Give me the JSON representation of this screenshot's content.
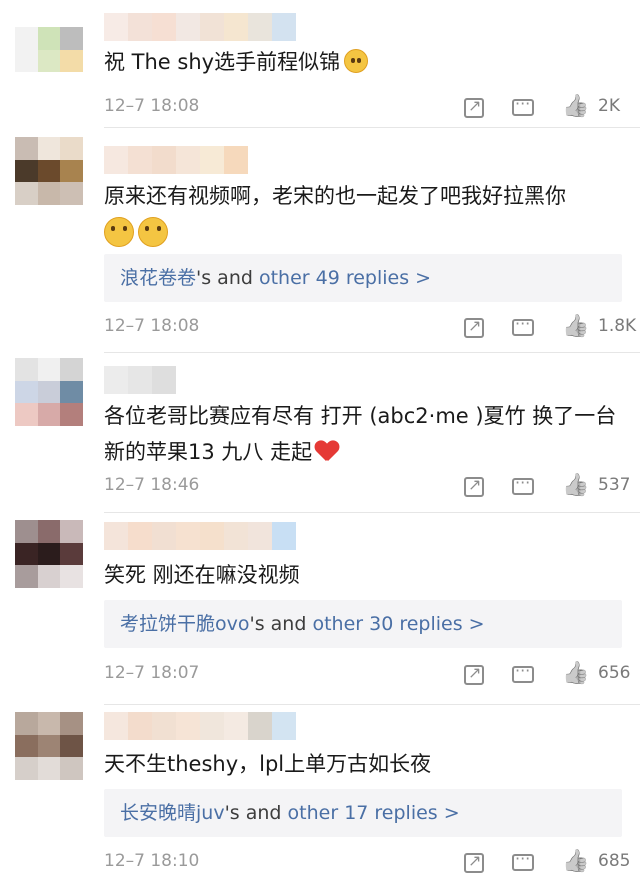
{
  "comments": [
    {
      "text": "祝 The shy选手前程似锦",
      "emojis": [
        "big-grin-emoji"
      ],
      "time": "12–7 18:08",
      "likes": "2K",
      "replies": null
    },
    {
      "text": "原来还有视频啊，老宋的也一起发了吧我好拉黑你",
      "emojis": [
        "crying-emoji",
        "crying-emoji"
      ],
      "time": "12–7 18:08",
      "likes": "1.8K",
      "replies": {
        "user": "浪花卷卷",
        "mid": "'s and ",
        "count": "other 49 replies >"
      }
    },
    {
      "text": "各位老哥比赛应有尽有  打开  (abc2·me )夏竹  换了一台新的苹果13  九八  走起",
      "emojis": [
        "red-heart-icon"
      ],
      "time": "12–7 18:46",
      "likes": "537",
      "replies": null
    },
    {
      "text": "笑死 刚还在嘛没视频",
      "emojis": [],
      "time": "12–7 18:07",
      "likes": "656",
      "replies": {
        "user": "考拉饼干脆ovo",
        "mid": "'s and ",
        "count": "other 30 replies >"
      }
    },
    {
      "text": "天不生theshy，lpl上单万古如长夜",
      "emojis": [],
      "time": "12–7 18:10",
      "likes": "685",
      "replies": {
        "user": "长安晚晴juv",
        "mid": "'s and ",
        "count": "other 17 replies >"
      }
    }
  ],
  "colors": {
    "link": "#4a6fa5",
    "meta": "#9a9a9a",
    "reply_bg": "#f4f4f6"
  }
}
